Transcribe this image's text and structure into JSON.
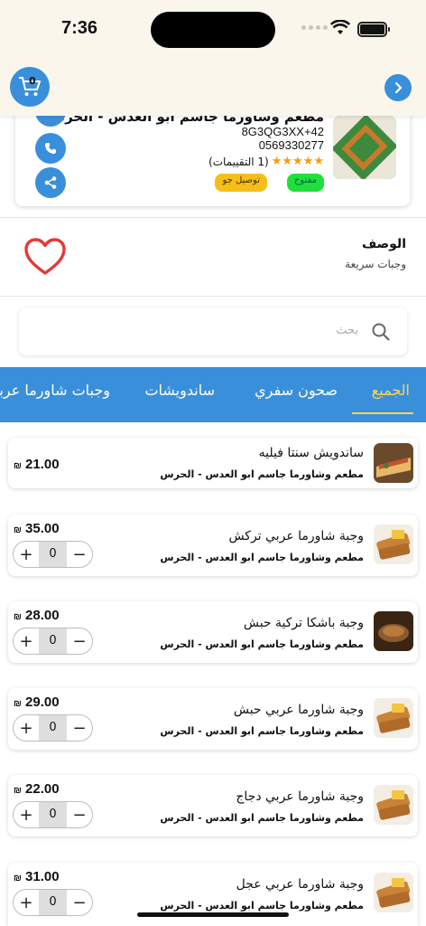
{
  "status_bar": {
    "time": "7:36"
  },
  "header": {
    "cart_count": "0"
  },
  "restaurant": {
    "name": "مطعم وشاورما جاسم ابو العدس - الحرس",
    "plus_code": "8G3QG3XX+42",
    "phone": "0569330277",
    "stars": "★★★★★",
    "rating_text": "(1 التقييمات)",
    "status_badge": "مفتوح",
    "delivery_badge": "توصيل جو"
  },
  "description": {
    "title": "الوصف",
    "text": "وجبات سريعة"
  },
  "search": {
    "placeholder": "بحث"
  },
  "tabs": [
    "الجميع",
    "صحون سفري",
    "ساندويشات",
    "وجبات شاورما عربي"
  ],
  "currency": "₪",
  "items": [
    {
      "name": "ساندويش سنتا فيليه",
      "restaurant": "مطعم وشاورما جاسم ابو العدس - الحرس",
      "price": "21.00",
      "qty": null
    },
    {
      "name": "وجبة شاورما عربي تركش",
      "restaurant": "مطعم وشاورما جاسم ابو العدس - الحرس",
      "price": "35.00",
      "qty": "0"
    },
    {
      "name": "وجبة باشكا تركية حبش",
      "restaurant": "مطعم وشاورما جاسم ابو العدس - الحرس",
      "price": "28.00",
      "qty": "0"
    },
    {
      "name": "وجبة شاورما عربي حبش",
      "restaurant": "مطعم وشاورما جاسم ابو العدس - الحرس",
      "price": "29.00",
      "qty": "0"
    },
    {
      "name": "وجبة شاورما عربي دجاج",
      "restaurant": "مطعم وشاورما جاسم ابو العدس - الحرس",
      "price": "22.00",
      "qty": "0"
    },
    {
      "name": "وجبة شاورما عربي عجل",
      "restaurant": "مطعم وشاورما جاسم ابو العدس - الحرس",
      "price": "31.00",
      "qty": "0"
    }
  ],
  "colors": {
    "accent": "#3a8fdb",
    "tab_active": "#ffd84a",
    "open": "#1fe03a",
    "delivery": "#f6bf17",
    "stars": "#f39c12",
    "heart": "#e53935"
  }
}
